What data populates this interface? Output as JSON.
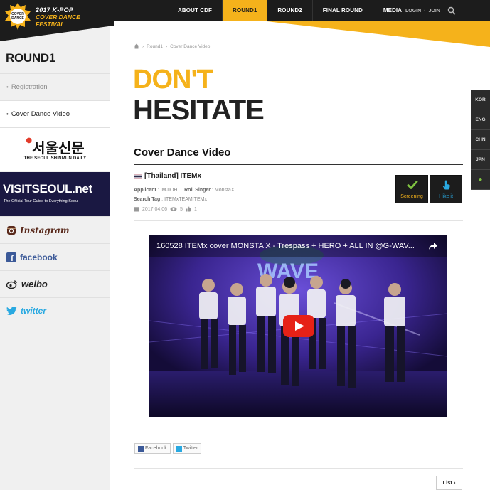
{
  "logo": {
    "badge_top": "K-POP",
    "badge_mid": "COVER",
    "badge_bot": "DANCE",
    "year_line": "2017 K-POP",
    "title_line1": "COVER DANCE",
    "title_line2": "FESTIVAL"
  },
  "nav": {
    "items": [
      {
        "label": "ABOUT CDF"
      },
      {
        "label": "ROUND1"
      },
      {
        "label": "ROUND2"
      },
      {
        "label": "FINAL ROUND"
      },
      {
        "label": "MEDIA"
      }
    ],
    "active": "ROUND1",
    "login": "LOGIN",
    "join": "JOIN",
    "separator": "·"
  },
  "sidebar": {
    "title": "ROUND1",
    "items": [
      {
        "label": "Registration"
      },
      {
        "label": "Cover Dance Video"
      }
    ],
    "banners": {
      "seoul_ko": "서울신문",
      "seoul_en": "THE SEOUL SHINMUN DAILY",
      "visit_main": "VISITSEOUL",
      "visit_net": ".net",
      "visit_sub": "The Official Tour Guide to Everything Seoul"
    },
    "social": {
      "instagram": "Instagram",
      "facebook": "facebook",
      "weibo": "weibo",
      "twitter": "twitter"
    }
  },
  "breadcrumb": {
    "crumb1": "Round1",
    "crumb2": "Cover Dance Video",
    "sep": "›"
  },
  "hero": {
    "line1": "DON'T",
    "line2": "HESITATE"
  },
  "section_title": "Cover Dance Video",
  "post": {
    "title": "[Thailand] ITEMx",
    "applicant_label": "Applicant",
    "applicant": "IMJIOH",
    "singer_label": "Roll Singer",
    "singer": "MonstaX",
    "tag_label": "Search Tag",
    "tag": "ITEMxTEAMITEMx",
    "date": "2017.04.06",
    "views": "5",
    "likes": "1"
  },
  "actions": {
    "screening": "Screening",
    "like": "I like it"
  },
  "video": {
    "title": "160528 ITEMx cover MONSTA X - Trespass + HERO + ALL IN @G-WAV..."
  },
  "share": {
    "facebook": "Facebook",
    "twitter": "Twitter"
  },
  "list_button": "List",
  "languages": [
    "KOR",
    "ENG",
    "CHN",
    "JPN"
  ],
  "colors": {
    "accent": "#f5b21b",
    "dark": "#1c1c1c",
    "green": "#7fc241",
    "youtube_red": "#e62117"
  }
}
